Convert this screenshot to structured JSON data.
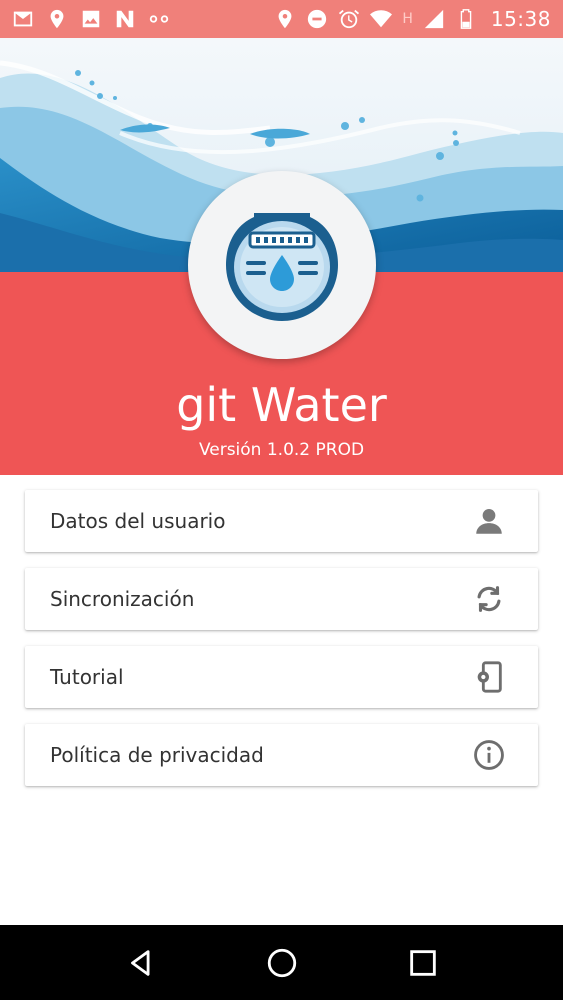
{
  "status_bar": {
    "time": "15:38",
    "h_indicator": "H",
    "left_icons": [
      "gmail-icon",
      "location-icon",
      "gallery-icon",
      "n-app-icon",
      "voicemail-icon"
    ],
    "right_icons": [
      "location-icon",
      "do-not-disturb-icon",
      "alarm-icon",
      "wifi-icon",
      "signal-icon",
      "battery-icon"
    ]
  },
  "header": {
    "app_title": "git Water",
    "version": "Versión 1.0.2 PROD",
    "band_color": "#ef5555",
    "logo": "water-meter-logo"
  },
  "menu": {
    "items": [
      {
        "label": "Datos del usuario",
        "icon": "person-icon"
      },
      {
        "label": "Sincronización",
        "icon": "sync-icon"
      },
      {
        "label": "Tutorial",
        "icon": "phone-settings-icon"
      },
      {
        "label": "Política de privacidad",
        "icon": "info-icon"
      }
    ]
  },
  "nav_bar": {
    "buttons": [
      "back-icon",
      "home-icon",
      "recents-icon"
    ]
  }
}
